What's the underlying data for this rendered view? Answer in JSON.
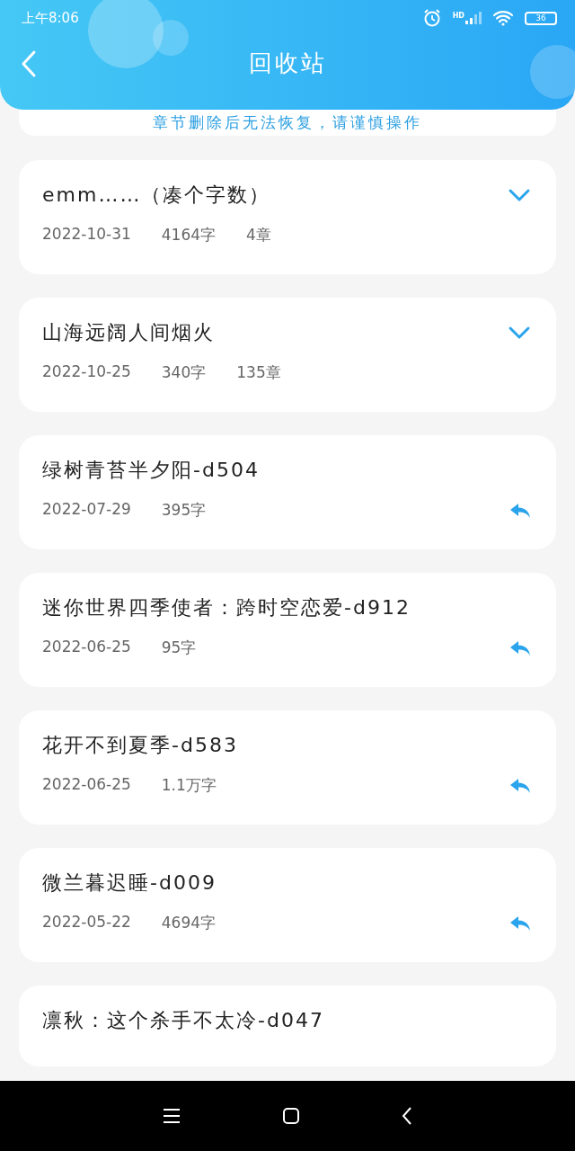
{
  "status_bar": {
    "time": "上午8:06",
    "network_label": "HD",
    "battery": "36"
  },
  "header": {
    "title": "回收站"
  },
  "notice": "章节删除后无法恢复，请谨慎操作",
  "items": [
    {
      "kind": "book",
      "title": "emm……（凑个字数）",
      "date": "2022-10-31",
      "words": "4164字",
      "chapters": "4章"
    },
    {
      "kind": "book",
      "title": "山海远阔人间烟火",
      "date": "2022-10-25",
      "words": "340字",
      "chapters": "135章"
    },
    {
      "kind": "chapter",
      "title": "绿树青苔半夕阳-d504",
      "date": "2022-07-29",
      "words": "395字"
    },
    {
      "kind": "chapter",
      "title": "迷你世界四季使者：跨时空恋爱-d912",
      "date": "2022-06-25",
      "words": "95字"
    },
    {
      "kind": "chapter",
      "title": "花开不到夏季-d583",
      "date": "2022-06-25",
      "words": "1.1万字"
    },
    {
      "kind": "chapter",
      "title": "微兰暮迟睡-d009",
      "date": "2022-05-22",
      "words": "4694字"
    },
    {
      "kind": "partial",
      "title": "凛秋：这个杀手不太冷-d047"
    }
  ]
}
